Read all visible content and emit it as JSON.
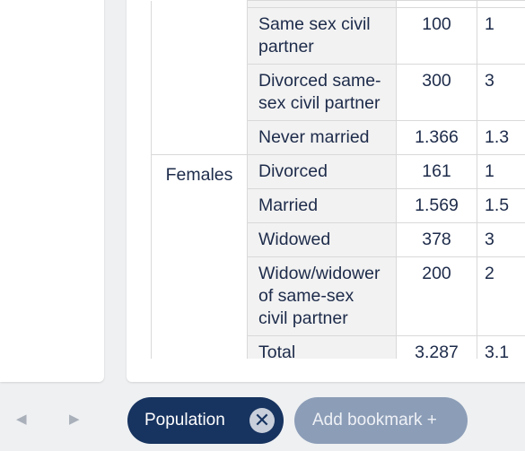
{
  "table": {
    "rows": [
      {
        "group": "",
        "label": "",
        "value": "",
        "value2": ""
      },
      {
        "group": "",
        "label": "Same sex civil partner",
        "value": "100",
        "value2": "1"
      },
      {
        "group": "",
        "label": "Divorced same-sex civil partner",
        "value": "300",
        "value2": "3"
      },
      {
        "group": "",
        "label": "Never married",
        "value": "1.366",
        "value2": "1.3"
      },
      {
        "group": "Females",
        "label": "Divorced",
        "value": "161",
        "value2": "1"
      },
      {
        "group": "",
        "label": "Married",
        "value": "1.569",
        "value2": "1.5"
      },
      {
        "group": "",
        "label": "Widowed",
        "value": "378",
        "value2": "3"
      },
      {
        "group": "",
        "label": "Widow/widower of same-sex civil partner",
        "value": "200",
        "value2": "2"
      },
      {
        "group": "",
        "label": "Total",
        "value": "3.287",
        "value2": "3.1"
      }
    ]
  },
  "bottom_bar": {
    "prev_icon": "chevron-left-icon",
    "next_icon": "chevron-right-icon",
    "prev_glyph": "◀",
    "next_glyph": "▶",
    "chip_label": "Population",
    "chip_close_icon": "close-icon",
    "chip_close_glyph": "✕",
    "add_bookmark_label": "Add bookmark +"
  }
}
